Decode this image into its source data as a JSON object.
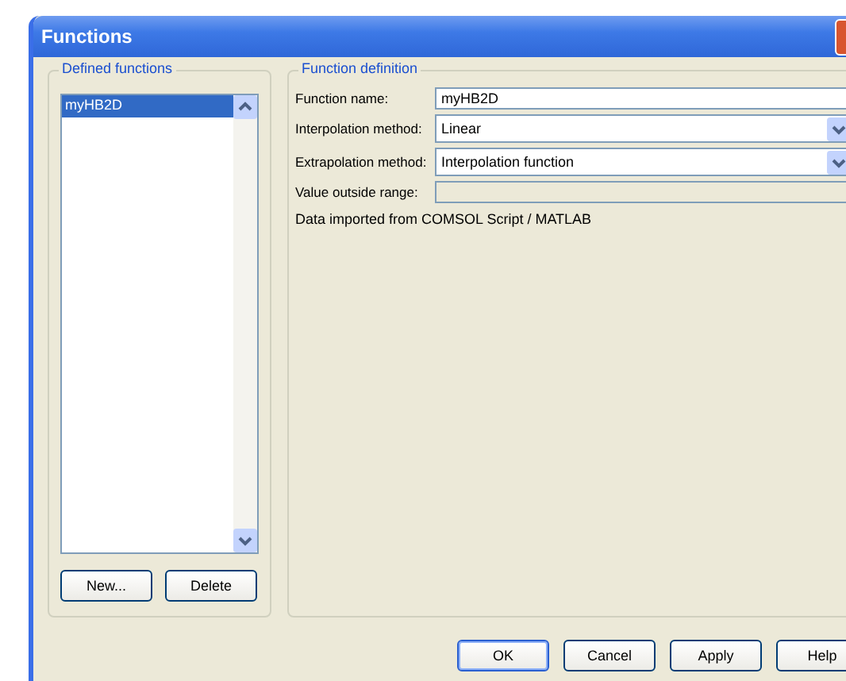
{
  "window": {
    "title": "Functions"
  },
  "defined_functions": {
    "legend": "Defined functions",
    "items": [
      {
        "label": "myHB2D",
        "selected": true
      }
    ],
    "buttons": [
      "New...",
      "Delete"
    ]
  },
  "function_definition": {
    "legend": "Function definition",
    "fields": [
      {
        "kind": "text",
        "label": "Function name:",
        "value": "myHB2D",
        "disabled": false
      },
      {
        "kind": "select",
        "label": "Interpolation method:",
        "value": "Linear",
        "disabled": false
      },
      {
        "kind": "select",
        "label": "Extrapolation method:",
        "value": "Interpolation function",
        "disabled": false
      },
      {
        "kind": "text",
        "label": "Value outside range:",
        "disabled": true
      }
    ],
    "note": "Data imported from COMSOL Script / MATLAB"
  },
  "buttons": [
    {
      "label": "OK",
      "default": true
    },
    {
      "label": "Cancel",
      "default": false
    },
    {
      "label": "Apply",
      "default": false
    },
    {
      "label": "Help",
      "default": false
    }
  ]
}
